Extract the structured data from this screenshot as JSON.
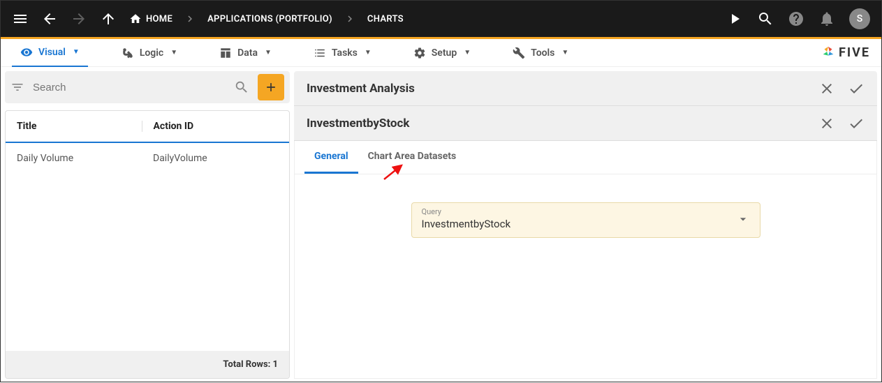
{
  "topbar": {
    "breadcrumb": [
      {
        "label": "HOME",
        "has_icon": true
      },
      {
        "label": "APPLICATIONS (PORTFOLIO)"
      },
      {
        "label": "CHARTS"
      }
    ],
    "avatar_letter": "S"
  },
  "menubar": {
    "items": [
      {
        "label": "Visual",
        "active": true
      },
      {
        "label": "Logic"
      },
      {
        "label": "Data"
      },
      {
        "label": "Tasks"
      },
      {
        "label": "Setup"
      },
      {
        "label": "Tools"
      }
    ],
    "logo_text": "FIVE"
  },
  "left": {
    "search_placeholder": "Search",
    "columns": {
      "title": "Title",
      "action_id": "Action ID"
    },
    "rows": [
      {
        "title": "Daily Volume",
        "action_id": "DailyVolume"
      }
    ],
    "footer": "Total Rows: 1"
  },
  "right": {
    "header1": "Investment Analysis",
    "header2": "InvestmentbyStock",
    "tabs": [
      {
        "label": "General",
        "active": true
      },
      {
        "label": "Chart Area Datasets"
      }
    ],
    "query_field": {
      "label": "Query",
      "value": "InvestmentbyStock"
    }
  }
}
